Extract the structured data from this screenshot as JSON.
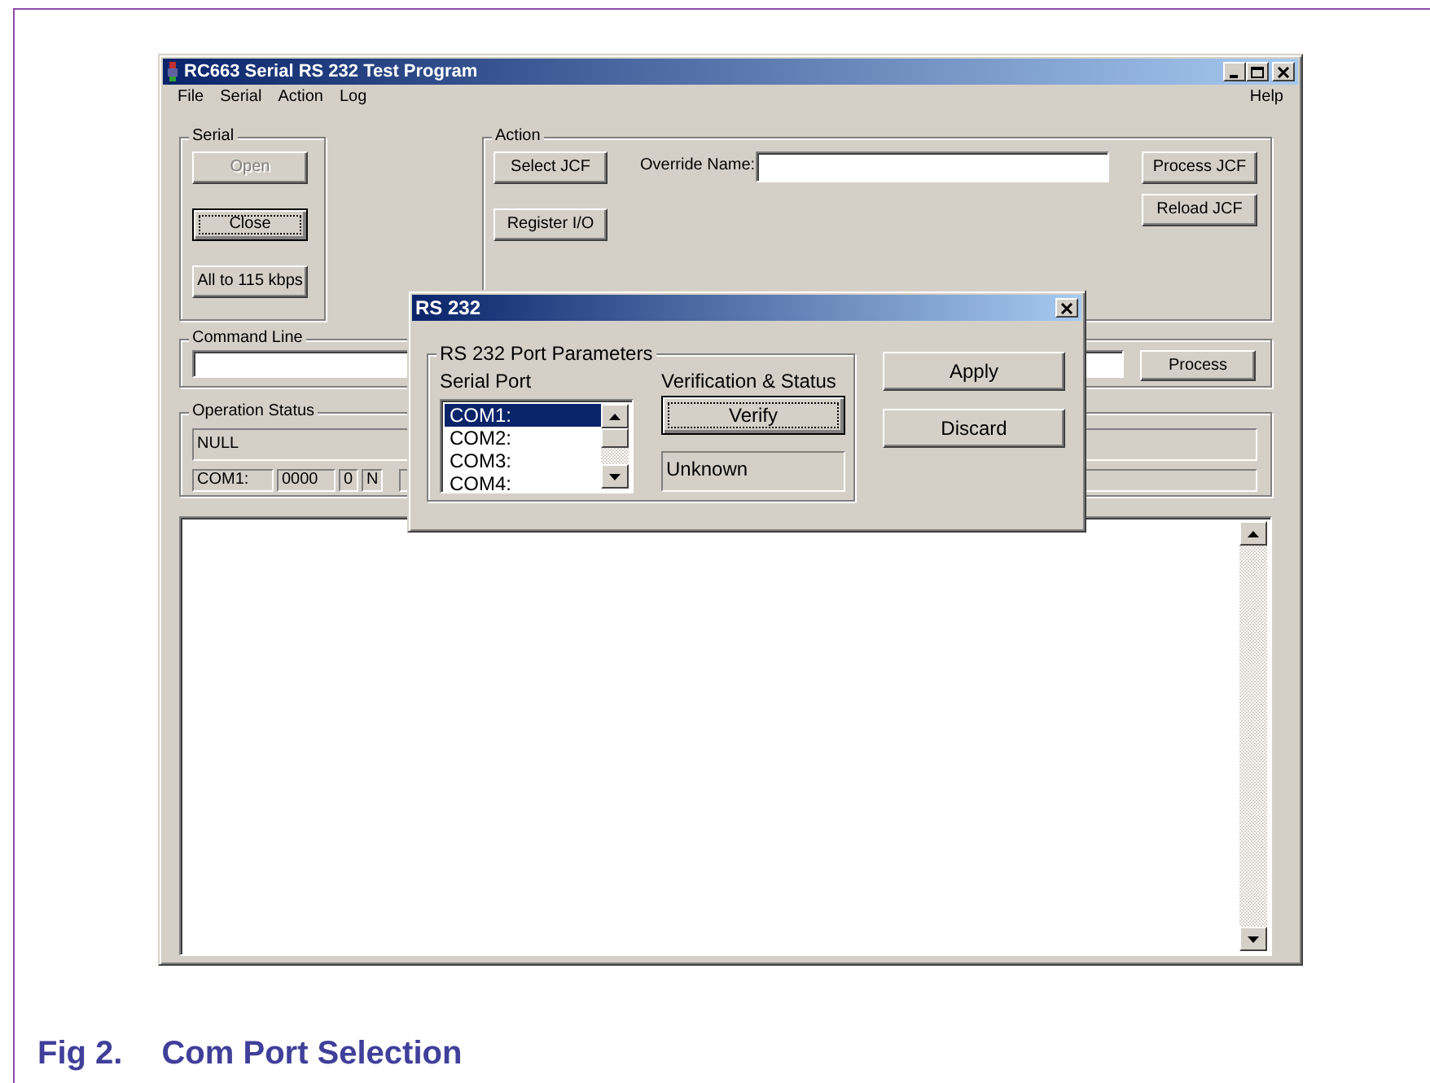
{
  "window": {
    "title": "RC663 Serial RS 232 Test Program",
    "menu": [
      "File",
      "Serial",
      "Action",
      "Log"
    ],
    "menu_right": [
      "Help"
    ]
  },
  "serial_group": {
    "title": "Serial",
    "buttons": [
      {
        "label": "Open",
        "disabled": true,
        "focused": false
      },
      {
        "label": "Close",
        "disabled": false,
        "focused": true
      },
      {
        "label": "All to 115 kbps",
        "disabled": false,
        "focused": false
      }
    ]
  },
  "action_group": {
    "title": "Action",
    "left_buttons": [
      {
        "label": "Select JCF"
      },
      {
        "label": "Register I/O"
      }
    ],
    "override_label": "Override Name:",
    "right_buttons": [
      {
        "label": "Process JCF"
      },
      {
        "label": "Reload JCF"
      }
    ]
  },
  "command_line": {
    "title": "Command Line",
    "button": {
      "label": "Process"
    }
  },
  "operation_status": {
    "title": "Operation Status",
    "status": "NULL",
    "port": "COM1:",
    "count": "0000",
    "field_3": "0",
    "field_4": "N"
  },
  "dialog": {
    "title": "RS 232",
    "group_title": "RS 232 Port Parameters",
    "serial_port_label": "Serial Port",
    "ports": [
      {
        "label": "COM1:",
        "selected": true
      },
      {
        "label": "COM2:",
        "selected": false
      },
      {
        "label": "COM3:",
        "selected": false
      },
      {
        "label": "COM4:",
        "selected": false
      }
    ],
    "verification_label": "Verification & Status",
    "verify_button": {
      "label": "Verify",
      "default": true
    },
    "status": "Unknown",
    "buttons": [
      {
        "label": "Apply"
      },
      {
        "label": "Discard"
      }
    ]
  },
  "caption": {
    "number": "Fig 2.",
    "title": "Com Port Selection"
  }
}
